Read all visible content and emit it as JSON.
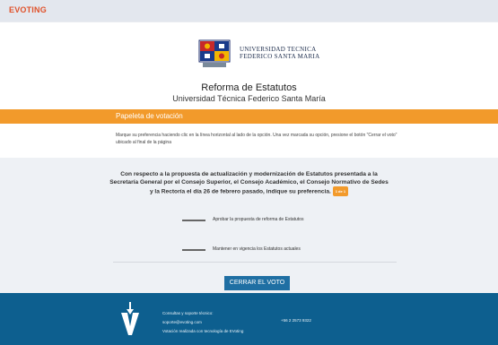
{
  "brand": {
    "name": "EVOTING"
  },
  "header": {
    "university_line1": "UNIVERSIDAD TECNICA",
    "university_line2": "FEDERICO SANTA MARIA",
    "title": "Reforma de Estatutos",
    "subtitle": "Universidad Técnica Federico Santa María"
  },
  "ballot": {
    "heading": "Papeleta de votación",
    "instructions": "Marque su preferencia haciendo clic en la línea horizontal al lado de la opción. Una vez marcada su opción, presione el botón \"Cerrar el voto\" ubicado al final de la página",
    "question": "Con respecto a la propuesta de actualización y modernización de Estatutos presentada a la Secretaría General por el Consejo Superior, el Consejo Académico, el Consejo Normativo de Sedes y la Rectoría el día 26 de febrero pasado, indique su preferencia.",
    "badge": "1 de 1",
    "options": [
      {
        "label": "Aprobar la propuesta de reforma de Estatutos"
      },
      {
        "label": "Mantener en vigencia los Estatutos actuales"
      }
    ],
    "close_button": "CERRAR EL VOTO"
  },
  "footer": {
    "support_title": "Consultas y soporte técnico:",
    "support_email": "soporte@evoting.com",
    "tech_note": "Votación realizada con tecnología de EVoting",
    "phone": "+56 2 2573 9322"
  },
  "colors": {
    "accent_orange": "#f29a2b",
    "brand_red": "#e0522b",
    "button_blue": "#1f6fa3",
    "footer_blue": "#0d5f8f"
  }
}
